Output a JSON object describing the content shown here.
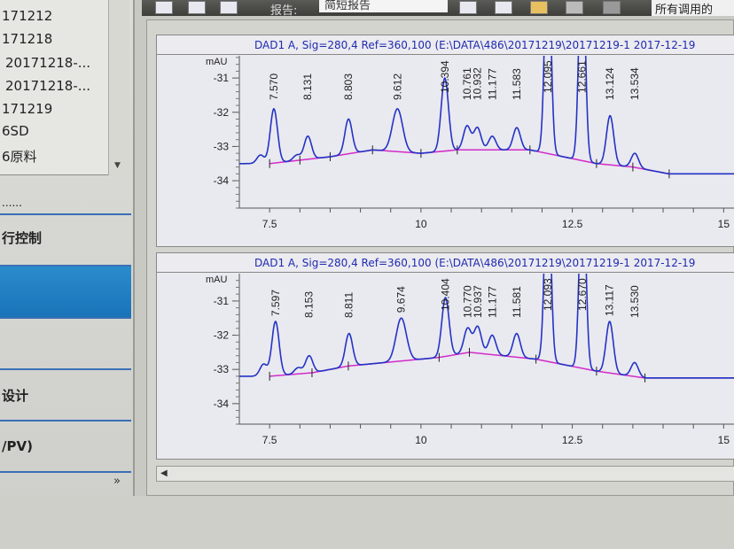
{
  "sidebar": {
    "list_items": [
      "171212",
      "171218",
      "20171218-...",
      "20171218-...",
      "171219",
      "6SD",
      "6原料"
    ],
    "sections": [
      "......",
      "行控制",
      "",
      "",
      "设计",
      "/PV)"
    ],
    "more": "»"
  },
  "toolbar": {
    "report_label": "报告:",
    "report_value": "简短报告",
    "call_value": "所有调用的"
  },
  "colors": {
    "trace": "#2433c4",
    "baseline": "#d22bc8",
    "title": "#1f2ab0",
    "selected": "#1a80c4"
  },
  "chart_data": [
    {
      "type": "line",
      "title": "DAD1 A, Sig=280,4 Ref=360,100 (E:\\DATA\\486\\20171219\\20171219-1 2017-12-19",
      "ylabel": "mAU",
      "yticks": [
        "-31",
        "-32",
        "-33",
        "-34"
      ],
      "xticks": [
        "7.5",
        "10",
        "12.5",
        "15"
      ],
      "xlim": [
        7.0,
        15.2
      ],
      "ylim": [
        -34.8,
        -30.35
      ],
      "peaks": [
        {
          "rt": "7.570",
          "h": -31.9
        },
        {
          "rt": "8.131",
          "h": -32.7
        },
        {
          "rt": "8.803",
          "h": -32.2
        },
        {
          "rt": "9.612",
          "h": -31.9
        },
        {
          "rt": "10.394",
          "h": -31.0
        },
        {
          "rt": "10.761",
          "h": -32.4
        },
        {
          "rt": "10.932",
          "h": -32.45
        },
        {
          "rt": "11.177",
          "h": -32.7
        },
        {
          "rt": "11.583",
          "h": -32.45
        },
        {
          "rt": "12.095",
          "h": -27
        },
        {
          "rt": "12.661",
          "h": -27
        },
        {
          "rt": "13.124",
          "h": -32.1
        },
        {
          "rt": "13.534",
          "h": -33.2
        }
      ],
      "minor_peaks": [
        {
          "rt": 7.35,
          "h": -33.25
        },
        {
          "rt": 7.95,
          "h": -33.25
        }
      ],
      "baseline": [
        [
          7.5,
          -33.5
        ],
        [
          8.0,
          -33.4
        ],
        [
          8.5,
          -33.3
        ],
        [
          9.2,
          -33.1
        ],
        [
          10.0,
          -33.2
        ],
        [
          10.6,
          -33.1
        ],
        [
          11.8,
          -33.1
        ],
        [
          12.9,
          -33.5
        ],
        [
          13.5,
          -33.6
        ],
        [
          14.1,
          -33.8
        ]
      ]
    },
    {
      "type": "line",
      "title": "DAD1 A, Sig=280,4 Ref=360,100 (E:\\DATA\\486\\20171219\\20171219-1 2017-12-19",
      "ylabel": "mAU",
      "yticks": [
        "-31",
        "-32",
        "-33",
        "-34"
      ],
      "xticks": [
        "7.5",
        "10",
        "12.5",
        "15"
      ],
      "xlim": [
        7.0,
        15.2
      ],
      "ylim": [
        -34.6,
        -30.2
      ],
      "peaks": [
        {
          "rt": "7.597",
          "h": -31.6
        },
        {
          "rt": "8.153",
          "h": -32.6
        },
        {
          "rt": "8.811",
          "h": -31.95
        },
        {
          "rt": "9.674",
          "h": -31.5
        },
        {
          "rt": "10.404",
          "h": -30.9
        },
        {
          "rt": "10.770",
          "h": -31.8
        },
        {
          "rt": "10.937",
          "h": -31.75
        },
        {
          "rt": "11.177",
          "h": -32.0
        },
        {
          "rt": "11.581",
          "h": -31.95
        },
        {
          "rt": "12.093",
          "h": -27
        },
        {
          "rt": "12.670",
          "h": -27
        },
        {
          "rt": "13.117",
          "h": -31.6
        },
        {
          "rt": "13.530",
          "h": -32.8
        }
      ],
      "minor_peaks": [
        {
          "rt": 7.4,
          "h": -32.85
        },
        {
          "rt": 7.97,
          "h": -32.95
        }
      ],
      "baseline": [
        [
          7.5,
          -33.2
        ],
        [
          8.2,
          -33.1
        ],
        [
          8.8,
          -32.9
        ],
        [
          10.3,
          -32.65
        ],
        [
          10.8,
          -32.5
        ],
        [
          11.9,
          -32.7
        ],
        [
          12.9,
          -33.05
        ],
        [
          13.7,
          -33.25
        ],
        [
          15.2,
          -33.25
        ]
      ]
    }
  ]
}
